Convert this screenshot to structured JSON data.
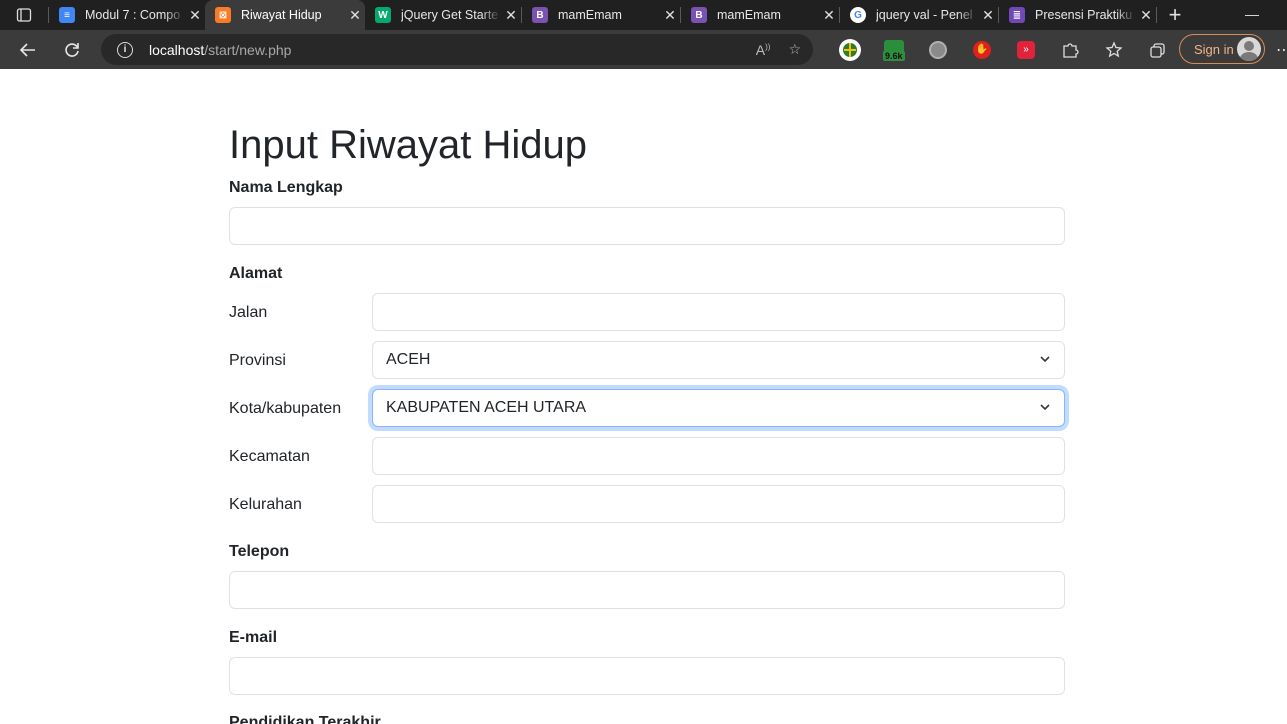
{
  "browser": {
    "tabs": [
      {
        "title": "Modul 7 : Compo",
        "icon": "google-docs-icon",
        "color": "#4285f4",
        "glyph": "≡"
      },
      {
        "title": "Riwayat Hidup",
        "icon": "xampp-icon",
        "color": "#fb7a24",
        "glyph": "⊠"
      },
      {
        "title": "jQuery Get Starte",
        "icon": "w3schools-icon",
        "color": "#04aa6d",
        "glyph": "W"
      },
      {
        "title": "mamEmam",
        "icon": "bootstrap-icon",
        "color": "#7952b3",
        "glyph": "B"
      },
      {
        "title": "mamEmam",
        "icon": "bootstrap-icon",
        "color": "#7952b3",
        "glyph": "B"
      },
      {
        "title": "jquery val - Penel",
        "icon": "google-icon",
        "color": "#ffffff",
        "glyph": "G"
      },
      {
        "title": "Presensi Praktiku",
        "icon": "google-forms-icon",
        "color": "#7248b9",
        "glyph": "≣"
      }
    ],
    "active_tab": 1,
    "url_host": "localhost",
    "url_path": "/start/new.php",
    "signin_label": "Sign in",
    "extension_badge": "9.6k"
  },
  "page": {
    "title": "Input Riwayat Hidup",
    "nama_label": "Nama Lengkap",
    "nama_value": "",
    "alamat_label": "Alamat",
    "jalan_label": "Jalan",
    "jalan_value": "",
    "provinsi_label": "Provinsi",
    "provinsi_value": "ACEH",
    "kota_label": "Kota/kabupaten",
    "kota_value": "KABUPATEN ACEH UTARA",
    "kecamatan_label": "Kecamatan",
    "kecamatan_value": "",
    "kelurahan_label": "Kelurahan",
    "kelurahan_value": "",
    "telepon_label": "Telepon",
    "telepon_value": "",
    "email_label": "E-mail",
    "email_value": "",
    "pendidikan_label": "Pendidikan Terakhir"
  }
}
